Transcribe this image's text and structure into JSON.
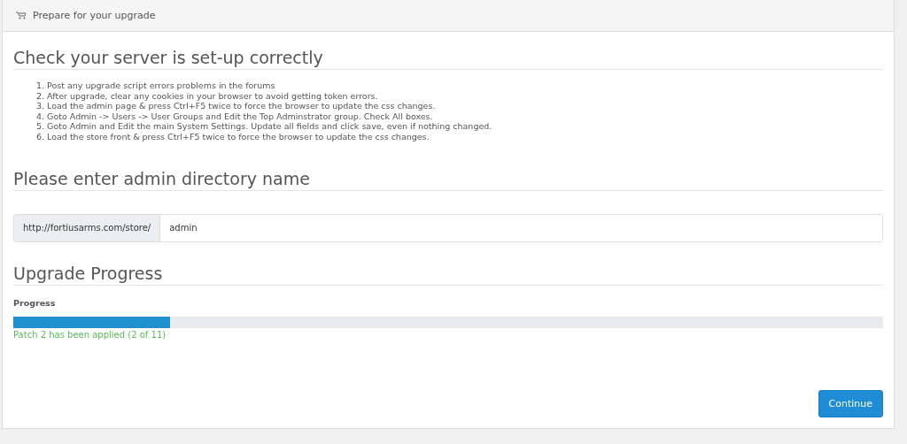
{
  "panel": {
    "title": "Prepare for your upgrade"
  },
  "checks": {
    "heading": "Check your server is set-up correctly",
    "steps": [
      {
        "number": "1.",
        "text": "Post any upgrade script errors problems in the forums"
      },
      {
        "number": "2.",
        "text": "After upgrade, clear any cookies in your browser to avoid getting token errors."
      },
      {
        "number": "3.",
        "text": "Load the admin page & press Ctrl+F5 twice to force the browser to update the css changes."
      },
      {
        "number": "4.",
        "text": "Goto Admin -> Users -> User Groups and Edit the Top Adminstrator group. Check All boxes."
      },
      {
        "number": "5.",
        "text": "Goto Admin and Edit the main System Settings. Update all fields and click save, even if nothing changed."
      },
      {
        "number": "6.",
        "text": "Load the store front & press Ctrl+F5 twice to force the browser to update the css changes."
      }
    ]
  },
  "admin_directory": {
    "heading": "Please enter admin directory name",
    "prefix": "http://fortiusarms.com/store/",
    "value": "admin"
  },
  "progress": {
    "heading": "Upgrade Progress",
    "label": "Progress",
    "level": 0.18,
    "status": "Patch 2 has been applied (2 of 11)"
  },
  "buttons": [
    {
      "label": "Continue"
    }
  ]
}
